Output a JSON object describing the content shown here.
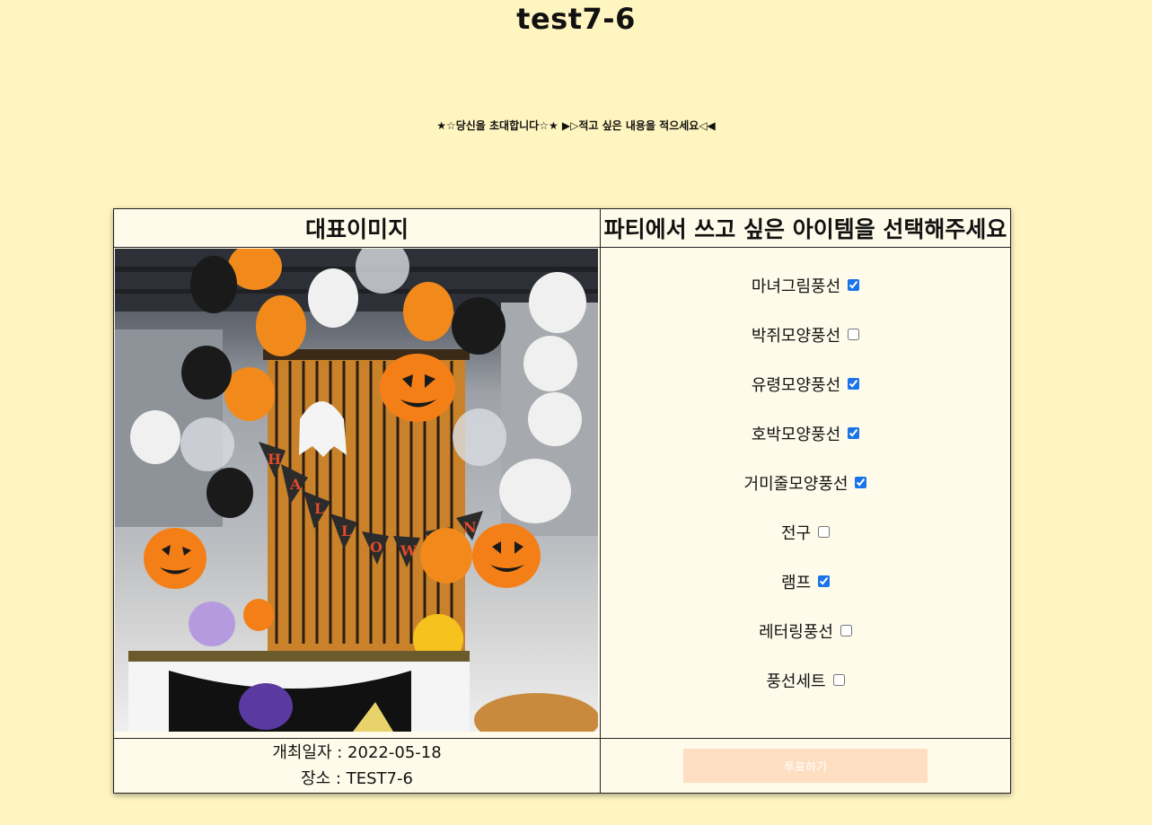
{
  "page": {
    "title": "test7-6",
    "subtitle": "★☆당신을 초대합니다☆★ ▶▷적고 싶은 내용을 적으세요◁◀"
  },
  "table": {
    "image_header": "대표이미지",
    "options_header": "파티에서 쓰고 싶은 아이템을 선택해주세요",
    "options": [
      {
        "label": "마녀그림풍선",
        "checked": true
      },
      {
        "label": "박쥐모양풍선",
        "checked": false
      },
      {
        "label": "유령모양풍선",
        "checked": true
      },
      {
        "label": "호박모양풍선",
        "checked": true
      },
      {
        "label": "거미줄모양풍선",
        "checked": true
      },
      {
        "label": "전구",
        "checked": false
      },
      {
        "label": "램프",
        "checked": true
      },
      {
        "label": "레터링풍선",
        "checked": false
      },
      {
        "label": "풍선세트",
        "checked": false
      }
    ],
    "date_text": "개최일자 : 2022-05-18",
    "place_text": "장소 : TEST7-6",
    "vote_label": "투표하기"
  },
  "colors": {
    "background": "#fff5c0",
    "table_background": "#fffbea",
    "vote_button": "#ffdfc2",
    "checkbox_accent": "#1a73e8"
  }
}
